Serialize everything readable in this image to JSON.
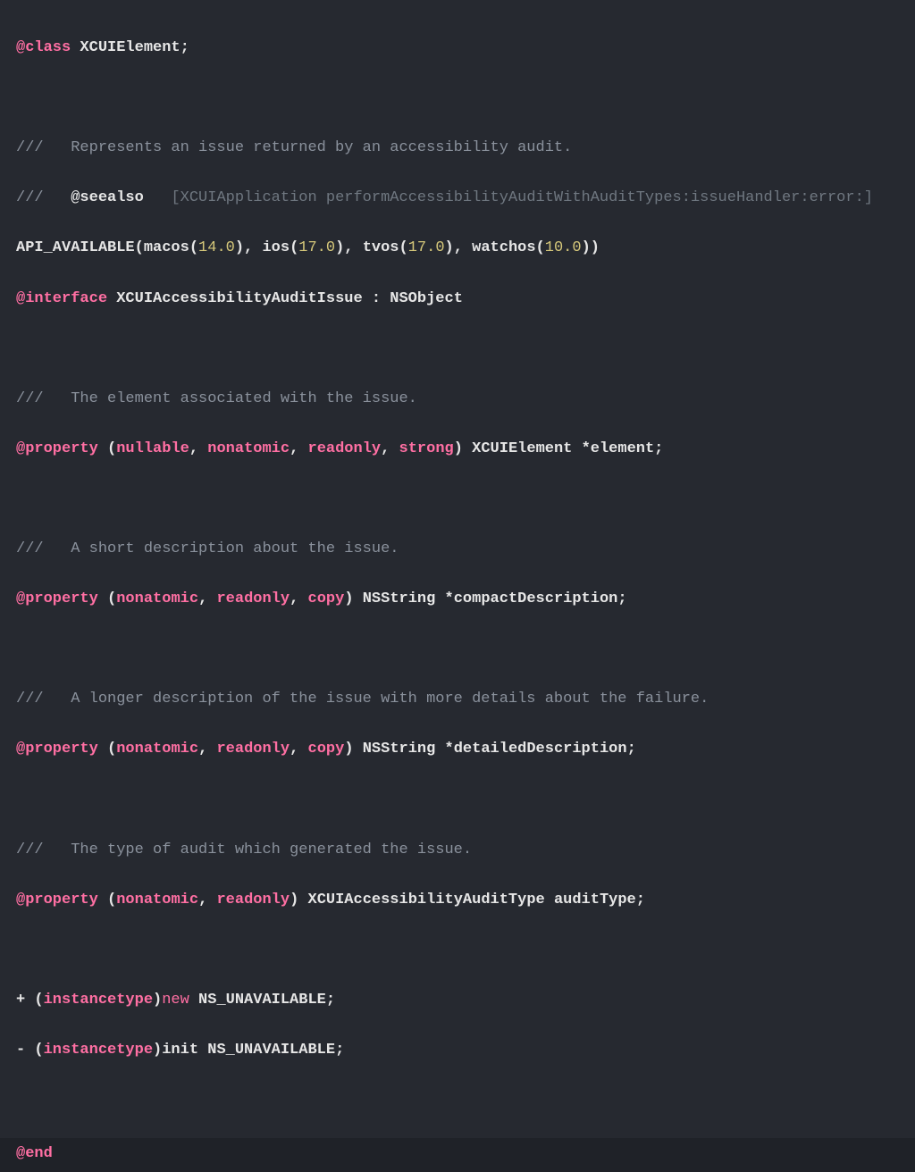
{
  "code": {
    "class_kw": "@class",
    "class_name": " XCUIElement;",
    "comment_represents": "///   Represents an issue returned by an accessibility audit.",
    "comment_seealso_prefix": "///   ",
    "seealso_tag": "@seealso",
    "seealso_ref": "   [XCUIApplication performAccessibilityAuditWithAuditTypes:issueHandler:error:]",
    "api_avail_1": "API_AVAILABLE(macos(",
    "api_v1": "14.0",
    "api_avail_2": "), ios(",
    "api_v2": "17.0",
    "api_avail_3": "), tvos(",
    "api_v3": "17.0",
    "api_avail_4": "), watchos(",
    "api_v4": "10.0",
    "api_avail_5": "))",
    "interface_kw": "@interface",
    "interface_rest": " XCUIAccessibilityAuditIssue : NSObject",
    "comment_element": "///   The element associated with the issue.",
    "prop_kw": "@property",
    "p1_open": " (",
    "p1_a1": "nullable",
    "p1_c1": ", ",
    "p1_a2": "nonatomic",
    "p1_c2": ", ",
    "p1_a3": "readonly",
    "p1_c3": ", ",
    "p1_a4": "strong",
    "p1_rest": ") XCUIElement *element;",
    "comment_short": "///   A short description about the issue.",
    "p2_open": " (",
    "p2_a1": "nonatomic",
    "p2_c1": ", ",
    "p2_a2": "readonly",
    "p2_c2": ", ",
    "p2_a3": "copy",
    "p2_rest": ") NSString *compactDescription;",
    "comment_long": "///   A longer description of the issue with more details about the failure.",
    "p3_open": " (",
    "p3_a1": "nonatomic",
    "p3_c1": ", ",
    "p3_a2": "readonly",
    "p3_c2": ", ",
    "p3_a3": "copy",
    "p3_rest": ") NSString *detailedDescription;",
    "comment_type": "///   The type of audit which generated the issue.",
    "p4_open": " (",
    "p4_a1": "nonatomic",
    "p4_c1": ", ",
    "p4_a2": "readonly",
    "p4_rest": ") XCUIAccessibilityAuditType auditType;",
    "m1_pre": "+ (",
    "m1_type": "instancetype",
    "m1_post": ")",
    "m1_name": "new",
    "m1_rest": " NS_UNAVAILABLE;",
    "m2_pre": "- (",
    "m2_type": "instancetype",
    "m2_post": ")init NS_UNAVAILABLE;",
    "end_kw": "@end"
  }
}
